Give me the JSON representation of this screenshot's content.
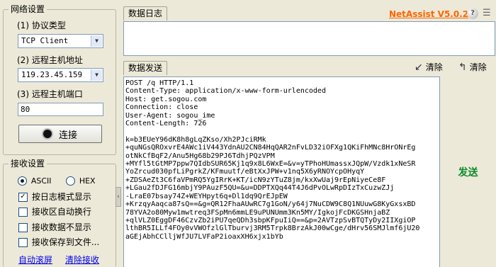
{
  "network_settings": {
    "title": "网络设置",
    "protocol_label": "(1) 协议类型",
    "protocol_value": "TCP Client",
    "host_label": "(2) 远程主机地址",
    "host_value": "119.23.45.159",
    "port_label": "(3) 远程主机端口",
    "port_value": "80",
    "connect_label": "连接"
  },
  "receive_settings": {
    "title": "接收设置",
    "ascii_label": "ASCII",
    "hex_label": "HEX",
    "log_mode_label": "按日志模式显示",
    "auto_wrap_label": "接收区自动换行",
    "hide_data_label": "接收数据不显示",
    "save_to_file_label": "接收保存到文件...",
    "auto_scroll_label": "自动滚屏",
    "clear_receive_label": "清除接收"
  },
  "data_log": {
    "tab_label": "数据日志"
  },
  "brand": {
    "name": "NetAssist V5.0.2",
    "color": "#ff6600"
  },
  "send_area": {
    "tab_label": "数据发送",
    "clear_label_1": "清除",
    "clear_label_2": "清除",
    "send_label": "发送",
    "send_color": "#0b8a2a",
    "lines": [
      "POST /q HTTP/1.1",
      "Content-Type: application/x-www-form-urlencoded",
      "Host: get.sogou.com",
      "Connection: close",
      "User-Agent: sogou_ime",
      "Content-Length: 726",
      "",
      "k=b3EUeY96dK8h8gLqZKso/Xh2PJciRMk",
      "+quNGsQROxvrE4AWc1iV443YdnAU2CN84HqQAR2nFvLD32iOFXg1QKiFhMNc8HrONrEg",
      "otNkCfBqF2/Anu5Hg68b29PJ6TdhjPQzVPM",
      "+MYfl5tGtMP7ppw7QIdbSUR65Kj1q9x8L6WxE=&v=yTPhoHUmassxJQpW/Vzdk1xNeSR",
      "YoZrcud030pfLiPgrkZ/KFmuutf/eBtXxJPW+v1nq5X6yRNOYcpOHyqY",
      "+ZDSAeZt3C6faVPmRQ5YgIRrK+KT/icN9zYTuZ8jm/kxXwUaj9rEpNiyeCe8F",
      "+LGau2fDJFG16mbjY9PAuzF5QU=&u=DDPTXQq44T4J6dPvOLwRpDIzTxCuzwZJj",
      "-LraE07bsay74Z+WEYHpyt6q+Dl1dq9QrEJpEW",
      "+KrzqyAaqca87sQ==&g=QR12FhaAUwRC7g1GoN/y64j7NuCDW9C8Q1NUuwG8KyGxsxBD",
      "78YVA2o80Myw1mwtreq3FSpMn6mmLE9uPUNUmm3Kn5MY/IgkojFcDKGSHnjaBZ",
      "+qlVLZ0EggDF46CzvZb2iPU7qeQDh3sbpKFpuIiQ==&p=2AVTzpSvBTQTyDy2IIXgiOP",
      "lthBR5ILLf4FOy0vVWOfzlGlTburvj3RM5Trpk8BrzAkJ00wCge/dHrv56SMJlmf6jU20",
      "aGEjAbhCClljWfJU7LVFaP2ioaxXH6xjx1bYb"
    ]
  }
}
